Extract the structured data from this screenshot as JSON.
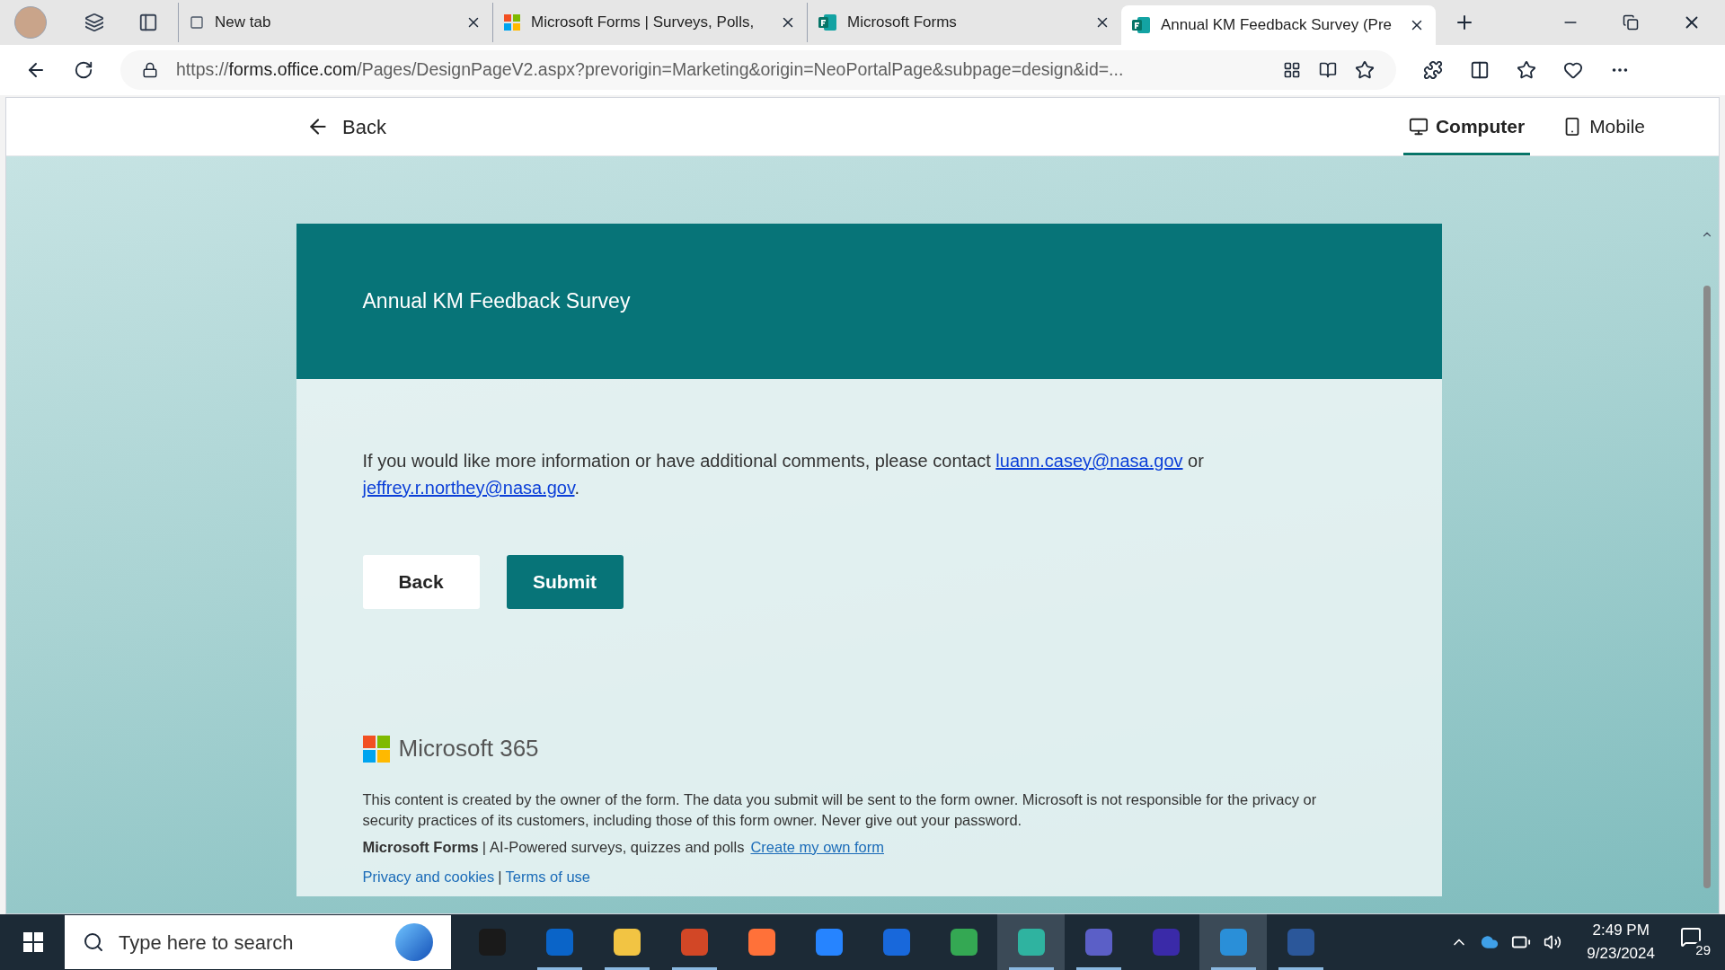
{
  "browser": {
    "tabs": [
      {
        "title": "New tab",
        "selected": false,
        "kind": "blank"
      },
      {
        "title": "Microsoft Forms | Surveys, Polls,",
        "selected": false,
        "kind": "grid"
      },
      {
        "title": "Microsoft Forms",
        "selected": false,
        "kind": "forms"
      },
      {
        "title": "Annual KM Feedback Survey (Pre",
        "selected": true,
        "kind": "forms"
      }
    ],
    "url": {
      "scheme": "https://",
      "host": "forms.office.com",
      "path": "/Pages/DesignPageV2.aspx?prevorigin=Marketing&origin=NeoPortalPage&subpage=design&id=..."
    }
  },
  "page_header": {
    "back": "Back",
    "views": [
      {
        "label": "Computer",
        "selected": true,
        "kind": "computer"
      },
      {
        "label": "Mobile",
        "selected": false,
        "kind": "mobile"
      }
    ]
  },
  "form": {
    "title": "Annual KM Feedback Survey",
    "message": [
      {
        "kind": "text",
        "text": "If you would like more information or have additional comments, please contact "
      },
      {
        "kind": "link",
        "text": "luann.casey@nasa.gov"
      },
      {
        "kind": "text",
        "text": " or "
      },
      {
        "kind": "link",
        "text": "jeffrey.r.northey@nasa.gov"
      },
      {
        "kind": "text",
        "text": "."
      }
    ],
    "buttons": [
      {
        "label": "Back",
        "kind": "secondary"
      },
      {
        "label": "Submit",
        "kind": "primary"
      }
    ]
  },
  "footer": {
    "brand": "Microsoft 365",
    "disclaimer": "This content is created by the owner of the form. The data you submit will be sent to the form owner. Microsoft is not responsible for the privacy or security practices of its customers, including those of this form owner. Never give out your password.",
    "product": "Microsoft Forms",
    "separator": "|",
    "tagline": "AI-Powered surveys, quizzes and polls",
    "create_link": "Create my own form",
    "links": [
      "Privacy and cookies",
      "Terms of use"
    ]
  },
  "taskbar": {
    "search_placeholder": "Type here to search",
    "apps": [
      {
        "color": "#1a1a1a",
        "running": false,
        "active": false
      },
      {
        "color": "#0a64c8",
        "running": true,
        "active": false
      },
      {
        "color": "#f2c443",
        "running": true,
        "active": false
      },
      {
        "color": "#d24726",
        "running": true,
        "active": false
      },
      {
        "color": "#ff7139",
        "running": false,
        "active": false
      },
      {
        "color": "#2684ff",
        "running": false,
        "active": false
      },
      {
        "color": "#1868db",
        "running": false,
        "active": false
      },
      {
        "color": "#34a853",
        "running": false,
        "active": false
      },
      {
        "color": "#2fb3a0",
        "running": true,
        "active": true
      },
      {
        "color": "#5b5fc7",
        "running": true,
        "active": false
      },
      {
        "color": "#3a2aa8",
        "running": false,
        "active": false
      },
      {
        "color": "#2a8fd8",
        "running": true,
        "active": true
      },
      {
        "color": "#2b579a",
        "running": true,
        "active": false
      }
    ],
    "time": "2:49 PM",
    "date": "9/23/2024",
    "notifications": "29"
  }
}
